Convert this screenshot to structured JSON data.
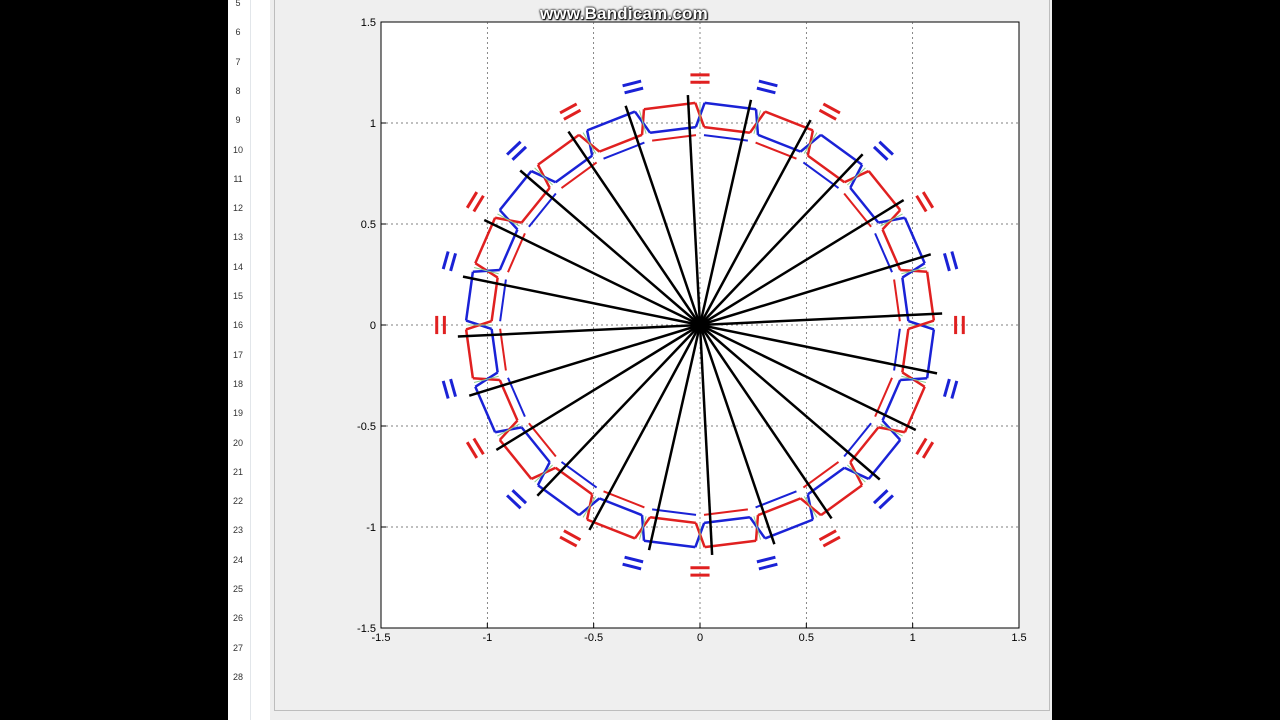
{
  "watermark": "www.Bandicam.com",
  "editor": {
    "line_numbers": [
      "5",
      "6",
      "7",
      "8",
      "9",
      "10",
      "11",
      "12",
      "13",
      "14",
      "15",
      "16",
      "17",
      "18",
      "19",
      "20",
      "21",
      "22",
      "23",
      "24",
      "25",
      "26",
      "27",
      "28"
    ]
  },
  "colors": {
    "outer_red": "#e02020",
    "outer_blue": "#1a22d6",
    "spokes": "#000000",
    "connectors": "#8fd08f",
    "grid": "#555555",
    "figure_bg": "#eeeeee",
    "axes_bg": "#ffffff"
  },
  "chart_data": {
    "type": "line",
    "title": "",
    "xlabel": "",
    "ylabel": "",
    "xlim": [
      -1.5,
      1.5
    ],
    "ylim": [
      -1.5,
      1.5
    ],
    "grid": true,
    "x_ticks": [
      "-1.5",
      "-1",
      "-0.5",
      "0",
      "0.5",
      "1",
      "1.5"
    ],
    "y_ticks": [
      "1.5",
      "1",
      "0.5",
      "0",
      "-0.5",
      "-1",
      "-1.5"
    ],
    "spoke_count": 24,
    "spoke_length": 1.14,
    "polygon_vertex_count": 24,
    "series": [
      {
        "color": "red",
        "radius_outer": 1.1,
        "radius_inner": 0.95
      },
      {
        "color": "blue",
        "radius_outer": 1.1,
        "radius_inner": 0.95
      }
    ],
    "marker_radius": 1.22
  }
}
